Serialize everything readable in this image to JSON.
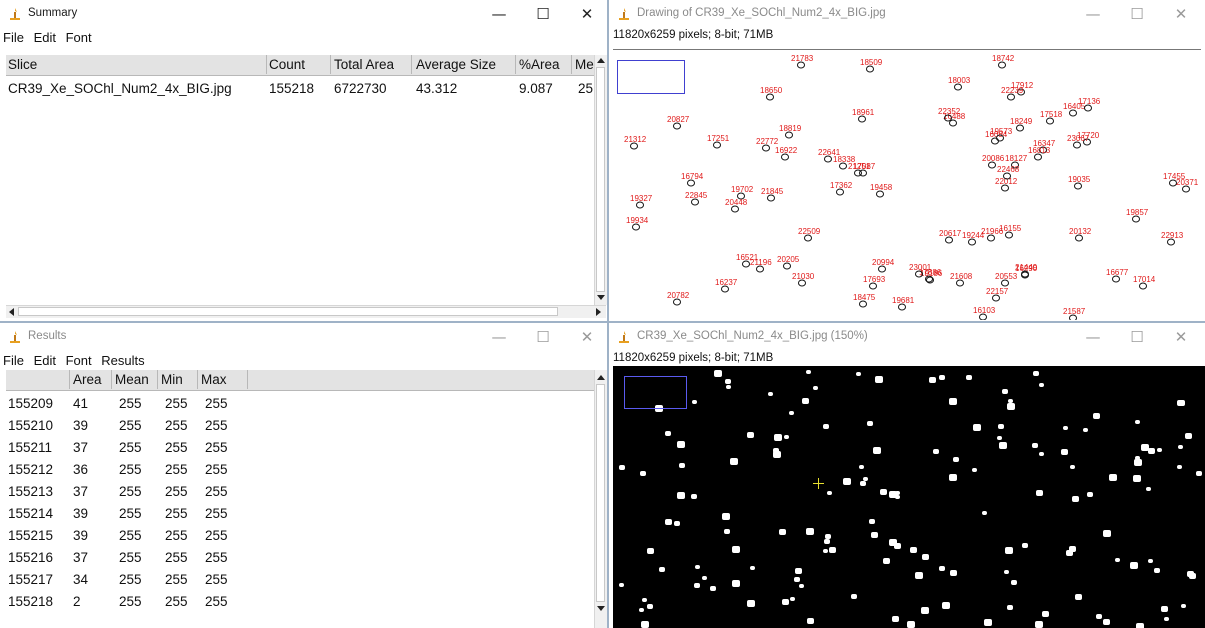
{
  "summary": {
    "title": "Summary",
    "controls": {
      "minimize": "—",
      "maximize": "☐",
      "close": "✕"
    },
    "menu": [
      "File",
      "Edit",
      "Font"
    ],
    "columns": [
      "Slice",
      "Count",
      "Total Area",
      "Average Size",
      "%Area",
      "Me"
    ],
    "row": [
      "CR39_Xe_SOChl_Num2_4x_BIG.jpg",
      "155218",
      "6722730",
      "43.312",
      "9.087",
      "25"
    ]
  },
  "results": {
    "title": "Results",
    "controls": {
      "minimize": "—",
      "maximize": "☐",
      "close": "✕"
    },
    "menu": [
      "File",
      "Edit",
      "Font",
      "Results"
    ],
    "columns": [
      "",
      "Area",
      "Mean",
      "Min",
      "Max"
    ],
    "rows": [
      [
        "155209",
        "41",
        "255",
        "255",
        "255"
      ],
      [
        "155210",
        "39",
        "255",
        "255",
        "255"
      ],
      [
        "155211",
        "37",
        "255",
        "255",
        "255"
      ],
      [
        "155212",
        "36",
        "255",
        "255",
        "255"
      ],
      [
        "155213",
        "37",
        "255",
        "255",
        "255"
      ],
      [
        "155214",
        "39",
        "255",
        "255",
        "255"
      ],
      [
        "155215",
        "39",
        "255",
        "255",
        "255"
      ],
      [
        "155216",
        "37",
        "255",
        "255",
        "255"
      ],
      [
        "155217",
        "34",
        "255",
        "255",
        "255"
      ],
      [
        "155218",
        "2",
        "255",
        "255",
        "255"
      ]
    ]
  },
  "drawing": {
    "title": "Drawing of CR39_Xe_SOChl_Num2_4x_BIG.jpg",
    "info": "11820x6259 pixels; 8-bit; 71MB",
    "controls": {
      "minimize": "—",
      "maximize": "☐",
      "close": "✕"
    },
    "label_color": "#e01818",
    "labels": [
      "16094",
      "16103",
      "16155",
      "16237",
      "16290",
      "16347",
      "16405",
      "16488",
      "16521",
      "16677",
      "16794",
      "16813",
      "16922",
      "17014",
      "17087",
      "17136",
      "17251",
      "17362",
      "17455",
      "17518",
      "17693",
      "17720",
      "17886",
      "17912",
      "18003",
      "18127",
      "18249",
      "18338",
      "18475",
      "18509",
      "18650",
      "18742",
      "18819",
      "18961",
      "19035",
      "19186",
      "19244",
      "19327",
      "19458",
      "19573",
      "19681",
      "19702",
      "19857",
      "19934",
      "20086",
      "20132",
      "20205",
      "20371",
      "20448",
      "20553",
      "20617",
      "20782",
      "20827",
      "20994",
      "21030",
      "21196",
      "21251",
      "21312",
      "21449",
      "21587",
      "21608",
      "21783",
      "21845",
      "21966",
      "22012",
      "22157",
      "22239",
      "22352",
      "22468",
      "22509",
      "22641",
      "22772",
      "22845",
      "22913",
      "23001",
      "23067"
    ]
  },
  "binary": {
    "title": "CR39_Xe_SOChl_Num2_4x_BIG.jpg (150%)",
    "info": "11820x6259 pixels; 8-bit; 71MB",
    "controls": {
      "minimize": "—",
      "maximize": "☐",
      "close": "✕"
    }
  }
}
